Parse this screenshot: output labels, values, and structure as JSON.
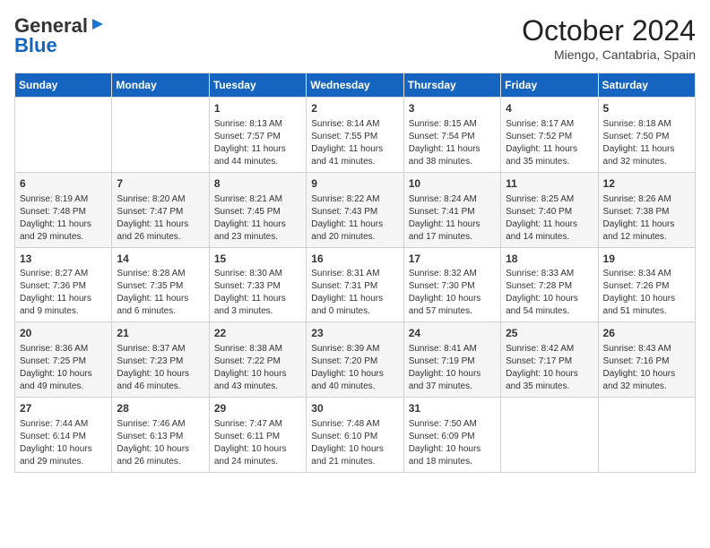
{
  "header": {
    "logo_line1": "General",
    "logo_line2": "Blue",
    "month_title": "October 2024",
    "location": "Miengo, Cantabria, Spain"
  },
  "weekdays": [
    "Sunday",
    "Monday",
    "Tuesday",
    "Wednesday",
    "Thursday",
    "Friday",
    "Saturday"
  ],
  "weeks": [
    [
      {
        "day": "",
        "info": ""
      },
      {
        "day": "",
        "info": ""
      },
      {
        "day": "1",
        "info": "Sunrise: 8:13 AM\nSunset: 7:57 PM\nDaylight: 11 hours and 44 minutes."
      },
      {
        "day": "2",
        "info": "Sunrise: 8:14 AM\nSunset: 7:55 PM\nDaylight: 11 hours and 41 minutes."
      },
      {
        "day": "3",
        "info": "Sunrise: 8:15 AM\nSunset: 7:54 PM\nDaylight: 11 hours and 38 minutes."
      },
      {
        "day": "4",
        "info": "Sunrise: 8:17 AM\nSunset: 7:52 PM\nDaylight: 11 hours and 35 minutes."
      },
      {
        "day": "5",
        "info": "Sunrise: 8:18 AM\nSunset: 7:50 PM\nDaylight: 11 hours and 32 minutes."
      }
    ],
    [
      {
        "day": "6",
        "info": "Sunrise: 8:19 AM\nSunset: 7:48 PM\nDaylight: 11 hours and 29 minutes."
      },
      {
        "day": "7",
        "info": "Sunrise: 8:20 AM\nSunset: 7:47 PM\nDaylight: 11 hours and 26 minutes."
      },
      {
        "day": "8",
        "info": "Sunrise: 8:21 AM\nSunset: 7:45 PM\nDaylight: 11 hours and 23 minutes."
      },
      {
        "day": "9",
        "info": "Sunrise: 8:22 AM\nSunset: 7:43 PM\nDaylight: 11 hours and 20 minutes."
      },
      {
        "day": "10",
        "info": "Sunrise: 8:24 AM\nSunset: 7:41 PM\nDaylight: 11 hours and 17 minutes."
      },
      {
        "day": "11",
        "info": "Sunrise: 8:25 AM\nSunset: 7:40 PM\nDaylight: 11 hours and 14 minutes."
      },
      {
        "day": "12",
        "info": "Sunrise: 8:26 AM\nSunset: 7:38 PM\nDaylight: 11 hours and 12 minutes."
      }
    ],
    [
      {
        "day": "13",
        "info": "Sunrise: 8:27 AM\nSunset: 7:36 PM\nDaylight: 11 hours and 9 minutes."
      },
      {
        "day": "14",
        "info": "Sunrise: 8:28 AM\nSunset: 7:35 PM\nDaylight: 11 hours and 6 minutes."
      },
      {
        "day": "15",
        "info": "Sunrise: 8:30 AM\nSunset: 7:33 PM\nDaylight: 11 hours and 3 minutes."
      },
      {
        "day": "16",
        "info": "Sunrise: 8:31 AM\nSunset: 7:31 PM\nDaylight: 11 hours and 0 minutes."
      },
      {
        "day": "17",
        "info": "Sunrise: 8:32 AM\nSunset: 7:30 PM\nDaylight: 10 hours and 57 minutes."
      },
      {
        "day": "18",
        "info": "Sunrise: 8:33 AM\nSunset: 7:28 PM\nDaylight: 10 hours and 54 minutes."
      },
      {
        "day": "19",
        "info": "Sunrise: 8:34 AM\nSunset: 7:26 PM\nDaylight: 10 hours and 51 minutes."
      }
    ],
    [
      {
        "day": "20",
        "info": "Sunrise: 8:36 AM\nSunset: 7:25 PM\nDaylight: 10 hours and 49 minutes."
      },
      {
        "day": "21",
        "info": "Sunrise: 8:37 AM\nSunset: 7:23 PM\nDaylight: 10 hours and 46 minutes."
      },
      {
        "day": "22",
        "info": "Sunrise: 8:38 AM\nSunset: 7:22 PM\nDaylight: 10 hours and 43 minutes."
      },
      {
        "day": "23",
        "info": "Sunrise: 8:39 AM\nSunset: 7:20 PM\nDaylight: 10 hours and 40 minutes."
      },
      {
        "day": "24",
        "info": "Sunrise: 8:41 AM\nSunset: 7:19 PM\nDaylight: 10 hours and 37 minutes."
      },
      {
        "day": "25",
        "info": "Sunrise: 8:42 AM\nSunset: 7:17 PM\nDaylight: 10 hours and 35 minutes."
      },
      {
        "day": "26",
        "info": "Sunrise: 8:43 AM\nSunset: 7:16 PM\nDaylight: 10 hours and 32 minutes."
      }
    ],
    [
      {
        "day": "27",
        "info": "Sunrise: 7:44 AM\nSunset: 6:14 PM\nDaylight: 10 hours and 29 minutes."
      },
      {
        "day": "28",
        "info": "Sunrise: 7:46 AM\nSunset: 6:13 PM\nDaylight: 10 hours and 26 minutes."
      },
      {
        "day": "29",
        "info": "Sunrise: 7:47 AM\nSunset: 6:11 PM\nDaylight: 10 hours and 24 minutes."
      },
      {
        "day": "30",
        "info": "Sunrise: 7:48 AM\nSunset: 6:10 PM\nDaylight: 10 hours and 21 minutes."
      },
      {
        "day": "31",
        "info": "Sunrise: 7:50 AM\nSunset: 6:09 PM\nDaylight: 10 hours and 18 minutes."
      },
      {
        "day": "",
        "info": ""
      },
      {
        "day": "",
        "info": ""
      }
    ]
  ]
}
